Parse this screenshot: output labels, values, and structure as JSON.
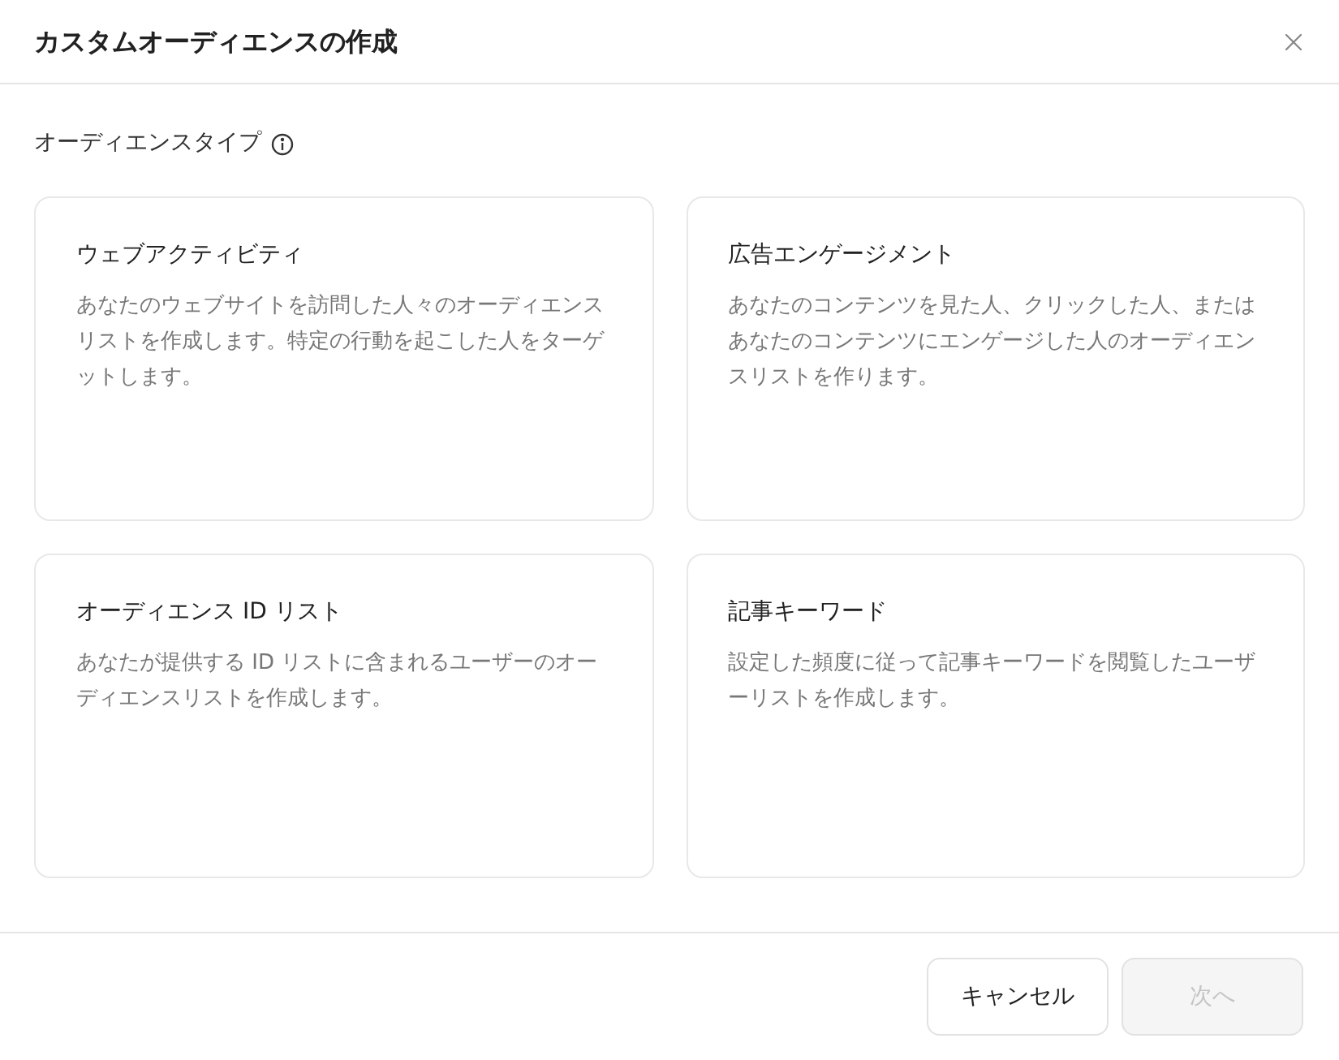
{
  "dialog": {
    "title": "カスタムオーディエンスの作成"
  },
  "section": {
    "label": "オーディエンスタイプ"
  },
  "options": [
    {
      "title": "ウェブアクティビティ",
      "description": "あなたのウェブサイトを訪問した人々のオーディエンスリストを作成します。特定の行動を起こした人をターゲットします。"
    },
    {
      "title": "広告エンゲージメント",
      "description": "あなたのコンテンツを見た人、クリックした人、またはあなたのコンテンツにエンゲージした人のオーディエンスリストを作ります。"
    },
    {
      "title": "オーディエンス ID リスト",
      "description": "あなたが提供する ID リストに含まれるユーザーのオーディエンスリストを作成します。"
    },
    {
      "title": "記事キーワード",
      "description": "設定した頻度に従って記事キーワードを閲覧したユーザーリストを作成します。"
    }
  ],
  "buttons": [
    {
      "label": "キャンセル",
      "disabled": false
    },
    {
      "label": "次へ",
      "disabled": true
    }
  ]
}
